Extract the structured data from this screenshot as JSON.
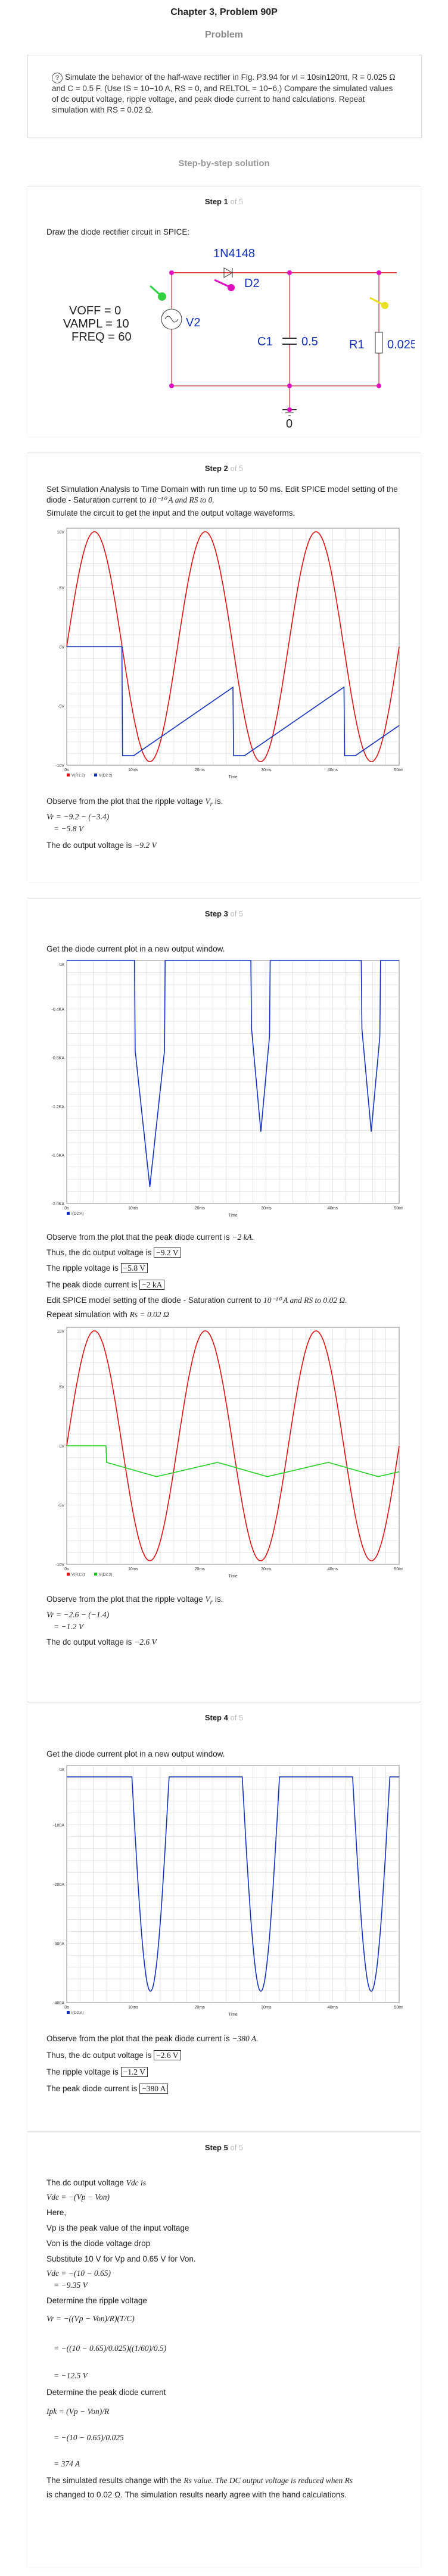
{
  "header": {
    "title": "Chapter 3, Problem 90P",
    "section": "Problem"
  },
  "problem": {
    "text": "Simulate the behavior of the half-wave rectifier in Fig. P3.94 for vI = 10sin120πt, R = 0.025 Ω and C = 0.5 F. (Use IS = 10−10 A, RS = 0, and RELTOL = 10−6.) Compare the simulated values of dc output voltage, ripple voltage, and peak diode current to hand calculations. Repeat simulation with RS = 0.02 Ω."
  },
  "sbs_label": "Step-by-step solution",
  "steps": {
    "s1": {
      "label": "Step 1",
      "of": "of 5",
      "intro": "Draw the diode rectifier circuit in SPICE:",
      "circuit": {
        "diode": "1N4148",
        "diode_ref": "D2",
        "src1": "VOFF = 0",
        "src2": "VAMPL = 10",
        "src3": "FREQ = 60",
        "src_ref": "V2",
        "cap_ref": "C1",
        "cap_val": "0.5",
        "res_ref": "R1",
        "res_val": "0.025",
        "gnd": "0"
      }
    },
    "s2": {
      "label": "Step 2",
      "of": "of 5",
      "l1": "Set Simulation Analysis to Time Domain with run time up to 50 ms. Edit SPICE model setting of the diode - Saturation current to",
      "l1b": "10⁻¹⁰ A and RS to 0.",
      "l2": "Simulate the circuit to get the input and the output voltage waveforms.",
      "obs": "Observe from the plot that the ripple voltage",
      "eq1": "Vr = −9.2 − (−3.4)",
      "eq2": "= −5.8 V",
      "dc": "The dc output voltage is",
      "dcv": "−9.2 V"
    },
    "s3": {
      "label": "Step 3",
      "of": "of 5",
      "intro": "Get the diode current plot in a new output window.",
      "obs1": "Observe from the plot that the peak diode current is",
      "obs1v": "−2 kA.",
      "dc": "Thus, the dc output voltage is",
      "dcv": "−9.2 V",
      "rip": "The ripple voltage is",
      "ripv": "−5.8 V",
      "pk": "The peak diode current is",
      "pkv": "−2 kA",
      "edit": "Edit SPICE model setting of the diode - Saturation current to",
      "editb": "10⁻¹⁰ A and RS to 0.02 Ω.",
      "rep": "Repeat simulation with",
      "repv": "Rs = 0.02 Ω",
      "obs2": "Observe from the plot that the ripple voltage",
      "eq1": "Vr = −2.6 − (−1.4)",
      "eq2": "= −1.2 V",
      "dc2": "The dc output voltage is",
      "dc2v": "−2.6 V"
    },
    "s4": {
      "label": "Step 4",
      "of": "of 5",
      "intro": "Get the diode current plot in a new output window.",
      "obs": "Observe from the plot that the peak diode current is",
      "obsv": "−380 A.",
      "dc": "Thus, the dc output voltage is",
      "dcv": "−2.6 V",
      "rip": "The ripple voltage is",
      "ripv": "−1.2 V",
      "pk": "The peak diode current is",
      "pkv": "−380 A"
    },
    "s5": {
      "label": "Step 5",
      "of": "of 5",
      "l1": "The dc output voltage",
      "l1v": "Vdc is",
      "eq0": "Vdc = −(Vp − Von)",
      "here": "Here,",
      "vp": "Vp is the peak value of the input voltage",
      "von": "Von is the diode voltage drop",
      "sub": "Substitute 10 V for Vp and 0.65 V for Von.",
      "eqa": "Vdc = −(10 − 0.65)",
      "eqb": "= −9.35 V",
      "rip": "Determine the ripple voltage",
      "eqr1": "Vr = −((Vp − Von)/R)(T/C)",
      "eqr2": "= −((10 − 0.65)/0.025)((1/60)/0.5)",
      "eqr3": "= −12.5 V",
      "pk": "Determine the peak diode current",
      "eqp1": "Ipk = (Vp − Von)/R",
      "eqp2": "= −(10 − 0.65)/0.025",
      "eqp3": "= 374 A",
      "concl1": "The simulated results change with the",
      "concl1b": "Rs value. The DC output voltage is reduced when Rs",
      "concl2": "is changed to 0.02 Ω. The simulation results nearly agree with the hand calculations."
    }
  },
  "chart_data": [
    {
      "type": "line",
      "title": "",
      "xlabel": "Time",
      "ylabel": "",
      "x_ticks": [
        "0s",
        "10ms",
        "20ms",
        "30ms",
        "40ms",
        "50ms"
      ],
      "y_ticks": [
        "10V",
        "5V",
        "0V",
        "-5V",
        "-10V"
      ],
      "ylim": [
        -10,
        10
      ],
      "series": [
        {
          "name": "V(R1:2)",
          "color": "#e01010",
          "values": "sin"
        },
        {
          "name": "V(D2:2)",
          "color": "#1030c0",
          "values": "rect"
        }
      ]
    },
    {
      "type": "line",
      "title": "",
      "xlabel": "Time",
      "ylabel": "",
      "x_ticks": [
        "0s",
        "10ms",
        "20ms",
        "30ms",
        "40ms",
        "50ms"
      ],
      "y_ticks": [
        "0A",
        "-0.4KA",
        "-0.8KA",
        "-1.2KA",
        "-1.6KA",
        "-2.0KA"
      ],
      "ylim": [
        -2.2,
        0
      ],
      "series": [
        {
          "name": "I(D2:A)",
          "color": "#1030c0",
          "values": "pulse"
        }
      ]
    },
    {
      "type": "line",
      "title": "",
      "xlabel": "Time",
      "ylabel": "",
      "x_ticks": [
        "0s",
        "10ms",
        "20ms",
        "30ms",
        "40ms",
        "50ms"
      ],
      "y_ticks": [
        "10V",
        "5V",
        "0V",
        "-5V",
        "-10V"
      ],
      "ylim": [
        -10,
        10
      ],
      "series": [
        {
          "name": "V(R1:2)",
          "color": "#e01010",
          "values": "sin"
        },
        {
          "name": "V(D2:2)",
          "color": "#20d020",
          "values": "ripple"
        }
      ]
    },
    {
      "type": "line",
      "title": "",
      "xlabel": "Time",
      "ylabel": "",
      "x_ticks": [
        "0s",
        "10ms",
        "20ms",
        "30ms",
        "40ms",
        "50ms"
      ],
      "y_ticks": [
        "0A",
        "-100A",
        "-200A",
        "-300A",
        "-400A"
      ],
      "ylim": [
        -400,
        20
      ],
      "series": [
        {
          "name": "I(D2:A)",
          "color": "#1030c0",
          "values": "pulse2"
        }
      ]
    }
  ]
}
